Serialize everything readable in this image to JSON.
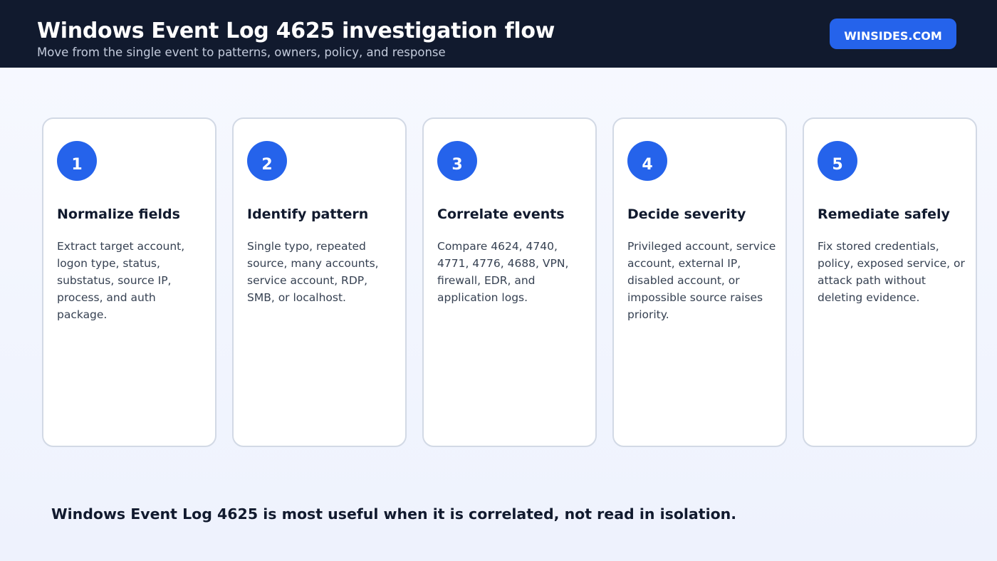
{
  "header": {
    "title": "Windows Event Log 4625 investigation flow",
    "subtitle": "Move from the single event to patterns, owners, policy, and response",
    "brand": "WINSIDES.COM"
  },
  "steps": [
    {
      "number": "1",
      "title": "Normalize fields",
      "text": "Extract target account, logon type, status, substatus, source IP, process, and auth package."
    },
    {
      "number": "2",
      "title": "Identify pattern",
      "text": "Single typo, repeated source, many accounts, service account, RDP, SMB, or localhost."
    },
    {
      "number": "3",
      "title": "Correlate events",
      "text": "Compare 4624, 4740, 4771, 4776, 4688, VPN, firewall, EDR, and application logs."
    },
    {
      "number": "4",
      "title": "Decide severity",
      "text": "Privileged account, service account, external IP, disabled account, or impossible source raises priority."
    },
    {
      "number": "5",
      "title": "Remediate safely",
      "text": "Fix stored credentials, policy, exposed service, or attack path without deleting evidence."
    }
  ],
  "footer": {
    "text": "Windows Event Log 4625 is most useful when it is correlated, not read in isolation."
  },
  "colors": {
    "header_bg": "#111a2e",
    "accent": "#2563eb",
    "card_border": "#d2d9e5",
    "text_dark": "#111a2e",
    "text_body": "#364152"
  }
}
